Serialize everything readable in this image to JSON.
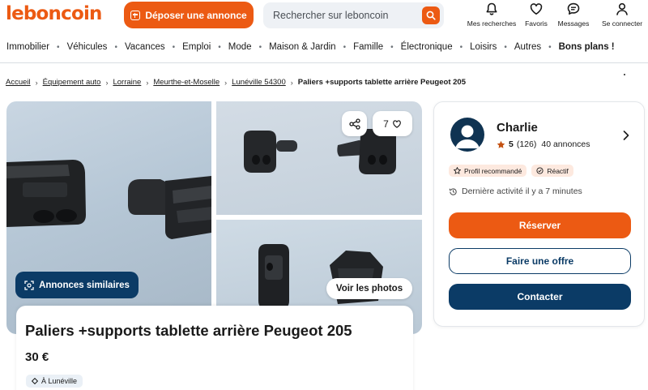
{
  "header": {
    "logo": "leboncoin",
    "deposit_label": "Déposer une annonce",
    "search_placeholder": "Rechercher sur leboncoin",
    "nav": [
      {
        "label": "Mes recherches",
        "icon": "bell-icon"
      },
      {
        "label": "Favoris",
        "icon": "heart-icon"
      },
      {
        "label": "Messages",
        "icon": "message-icon"
      },
      {
        "label": "Se connecter",
        "icon": "user-icon"
      }
    ]
  },
  "categories": [
    "Immobilier",
    "Véhicules",
    "Vacances",
    "Emploi",
    "Mode",
    "Maison & Jardin",
    "Famille",
    "Électronique",
    "Loisirs",
    "Autres",
    "Bons plans !"
  ],
  "breadcrumb": [
    "Accueil",
    "Équipement auto",
    "Lorraine",
    "Meurthe-et-Moselle",
    "Lunéville 54300",
    "Paliers +supports tablette arrière Peugeot 205"
  ],
  "gallery": {
    "favorites_count": "7",
    "similar_label": "Annonces similaires",
    "photos_label": "Voir les photos"
  },
  "listing": {
    "title": "Paliers +supports tablette arrière Peugeot 205",
    "price": "30 €",
    "location": "À Lunéville"
  },
  "seller": {
    "name": "Charlie",
    "rating": "5",
    "reviews": "(126)",
    "listings": "40 annonces",
    "badges": [
      "Profil recommandé",
      "Réactif"
    ],
    "activity": "Dernière activité il y a 7 minutes",
    "reserve_label": "Réserver",
    "offer_label": "Faire une offre",
    "contact_label": "Contacter"
  },
  "colors": {
    "brand_orange": "#ec5a13",
    "navy": "#0b3b66"
  }
}
